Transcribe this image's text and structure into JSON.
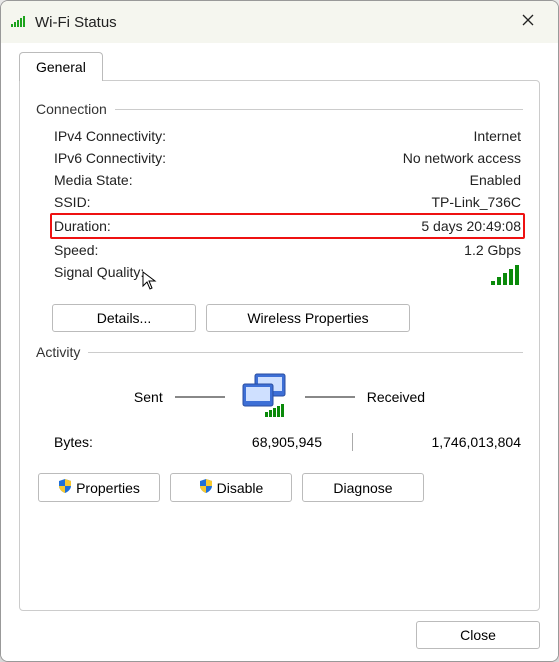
{
  "window": {
    "title": "Wi-Fi Status"
  },
  "tabs": {
    "general": "General"
  },
  "connection": {
    "header": "Connection",
    "ipv4_label": "IPv4 Connectivity:",
    "ipv4_value": "Internet",
    "ipv6_label": "IPv6 Connectivity:",
    "ipv6_value": "No network access",
    "media_label": "Media State:",
    "media_value": "Enabled",
    "ssid_label": "SSID:",
    "ssid_value": "TP-Link_736C",
    "duration_label": "Duration:",
    "duration_value": "5 days 20:49:08",
    "speed_label": "Speed:",
    "speed_value": "1.2 Gbps",
    "signal_label": "Signal Quality:"
  },
  "buttons": {
    "details": "Details...",
    "wireless_properties": "Wireless Properties",
    "properties": "Properties",
    "disable": "Disable",
    "diagnose": "Diagnose",
    "close": "Close"
  },
  "activity": {
    "header": "Activity",
    "sent_label": "Sent",
    "received_label": "Received",
    "bytes_label": "Bytes:",
    "sent_value": "68,905,945",
    "received_value": "1,746,013,804"
  }
}
